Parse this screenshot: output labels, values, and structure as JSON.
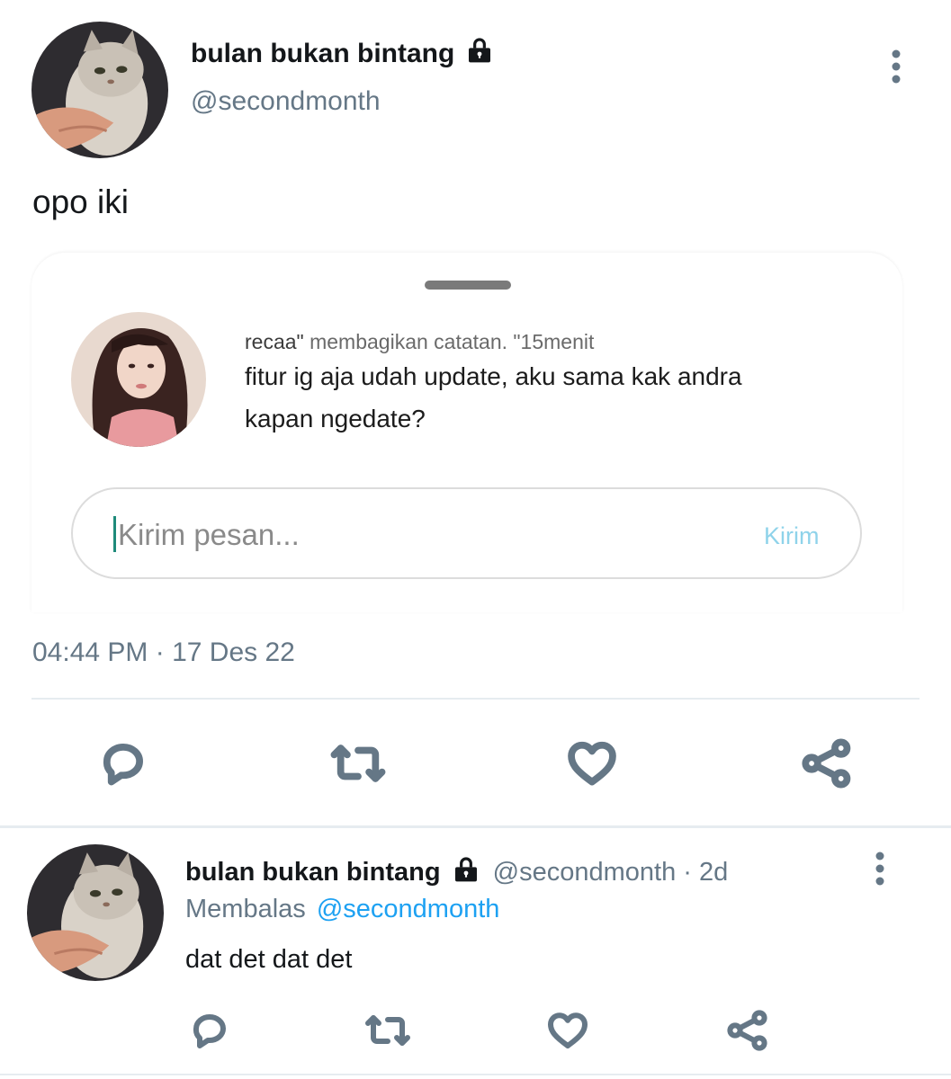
{
  "tweet": {
    "display_name": "bulan bukan bintang",
    "handle": "@secondmonth",
    "text": "opo iki",
    "timestamp": "04:44 PM · 17 Des 22",
    "lock_icon": "lock-icon",
    "more_icon": "more-vertical-icon"
  },
  "embed": {
    "sender": "recaa\"",
    "action": "membagikan catatan. \"15menit",
    "note_line1": "fitur ig aja udah update, aku sama kak andra",
    "note_line2": "kapan ngedate?",
    "input_placeholder": "Kirim pesan...",
    "send_label": "Kirim",
    "send_color": "#8fd3ea"
  },
  "actions": {
    "reply_icon": "comment-icon",
    "retweet_icon": "retweet-icon",
    "like_icon": "heart-icon",
    "share_icon": "share-icon"
  },
  "reply": {
    "display_name": "bulan bukan bintang",
    "handle": "@secondmonth",
    "age": "· 2d",
    "replying_label": "Membalas",
    "replying_to": "@secondmonth",
    "text": "dat det dat det",
    "mention_color": "#1da1f2"
  }
}
